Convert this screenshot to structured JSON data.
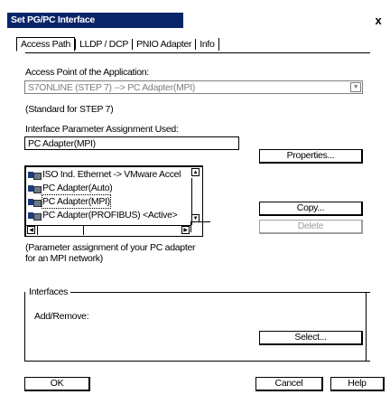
{
  "window": {
    "title": "Set PG/PC Interface",
    "close_label": "x"
  },
  "tabs": [
    {
      "label": "Access Path"
    },
    {
      "label": "LLDP / DCP"
    },
    {
      "label": "PNIO Adapter"
    },
    {
      "label": "Info"
    }
  ],
  "access_point": {
    "label": "Access Point of the Application:",
    "value": "S7ONLINE    (STEP 7)    --> PC Adapter(MPI)",
    "note": "(Standard for STEP 7)"
  },
  "interface_param": {
    "label": "Interface Parameter Assignment Used:",
    "value": "PC Adapter(MPI)",
    "properties_button": "Properties...",
    "copy_button": "Copy...",
    "delete_button": "Delete"
  },
  "interface_list": {
    "items": [
      {
        "label": "ISO Ind. Ethernet -> VMware Accel"
      },
      {
        "label": "PC Adapter(Auto)"
      },
      {
        "label": "PC Adapter(MPI)",
        "selected": true
      },
      {
        "label": "PC Adapter(PROFIBUS)  <Active>"
      }
    ]
  },
  "description": {
    "line1": "(Parameter assignment of your PC adapter",
    "line2": "for an MPI network)"
  },
  "interfaces_group": {
    "title": "Interfaces",
    "add_remove_label": "Add/Remove:",
    "select_button": "Select..."
  },
  "footer": {
    "ok_button": "OK",
    "cancel_button": "Cancel",
    "help_button": "Help"
  },
  "colors": {
    "titlebar": "#0a246a",
    "disabled_text": "#9f9f9f"
  }
}
